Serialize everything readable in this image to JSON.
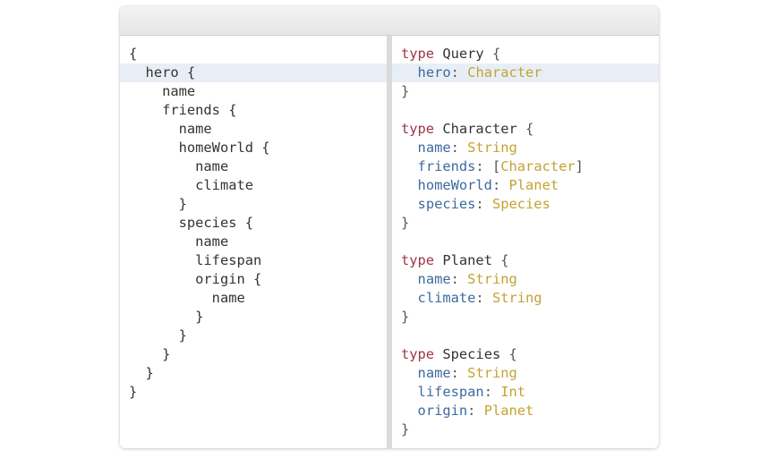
{
  "window": {
    "title": ""
  },
  "query_editor": {
    "lines": [
      {
        "indent": 0,
        "text": "{",
        "highlighted": false
      },
      {
        "indent": 1,
        "text": "hero {",
        "highlighted": true
      },
      {
        "indent": 2,
        "text": "name",
        "highlighted": false
      },
      {
        "indent": 2,
        "text": "friends {",
        "highlighted": false
      },
      {
        "indent": 3,
        "text": "name",
        "highlighted": false
      },
      {
        "indent": 3,
        "text": "homeWorld {",
        "highlighted": false
      },
      {
        "indent": 4,
        "text": "name",
        "highlighted": false
      },
      {
        "indent": 4,
        "text": "climate",
        "highlighted": false
      },
      {
        "indent": 3,
        "text": "}",
        "highlighted": false
      },
      {
        "indent": 3,
        "text": "species {",
        "highlighted": false
      },
      {
        "indent": 4,
        "text": "name",
        "highlighted": false
      },
      {
        "indent": 4,
        "text": "lifespan",
        "highlighted": false
      },
      {
        "indent": 4,
        "text": "origin {",
        "highlighted": false
      },
      {
        "indent": 5,
        "text": "name",
        "highlighted": false
      },
      {
        "indent": 4,
        "text": "}",
        "highlighted": false
      },
      {
        "indent": 3,
        "text": "}",
        "highlighted": false
      },
      {
        "indent": 2,
        "text": "}",
        "highlighted": false
      },
      {
        "indent": 1,
        "text": "}",
        "highlighted": false
      },
      {
        "indent": 0,
        "text": "}",
        "highlighted": false
      }
    ]
  },
  "schema_view": {
    "types": [
      {
        "keyword": "type",
        "name": "Query",
        "open": "{",
        "close": "}",
        "fields": [
          {
            "name": "hero",
            "type": "Character",
            "highlighted": true
          }
        ],
        "highlighted": false
      },
      {
        "keyword": "type",
        "name": "Character",
        "open": "{",
        "close": "}",
        "fields": [
          {
            "name": "name",
            "type": "String"
          },
          {
            "name": "friends",
            "type": "Character",
            "list": true
          },
          {
            "name": "homeWorld",
            "type": "Planet"
          },
          {
            "name": "species",
            "type": "Species"
          }
        ]
      },
      {
        "keyword": "type",
        "name": "Planet",
        "open": "{",
        "close": "}",
        "fields": [
          {
            "name": "name",
            "type": "String"
          },
          {
            "name": "climate",
            "type": "String"
          }
        ]
      },
      {
        "keyword": "type",
        "name": "Species",
        "open": "{",
        "close": "}",
        "fields": [
          {
            "name": "name",
            "type": "String"
          },
          {
            "name": "lifespan",
            "type": "Int"
          },
          {
            "name": "origin",
            "type": "Planet"
          }
        ]
      }
    ]
  },
  "colors": {
    "keyword": "#a0344a",
    "field": "#3d6aa0",
    "type": "#c4a234",
    "highlight": "#e8eef5",
    "divider": "#dadada"
  }
}
